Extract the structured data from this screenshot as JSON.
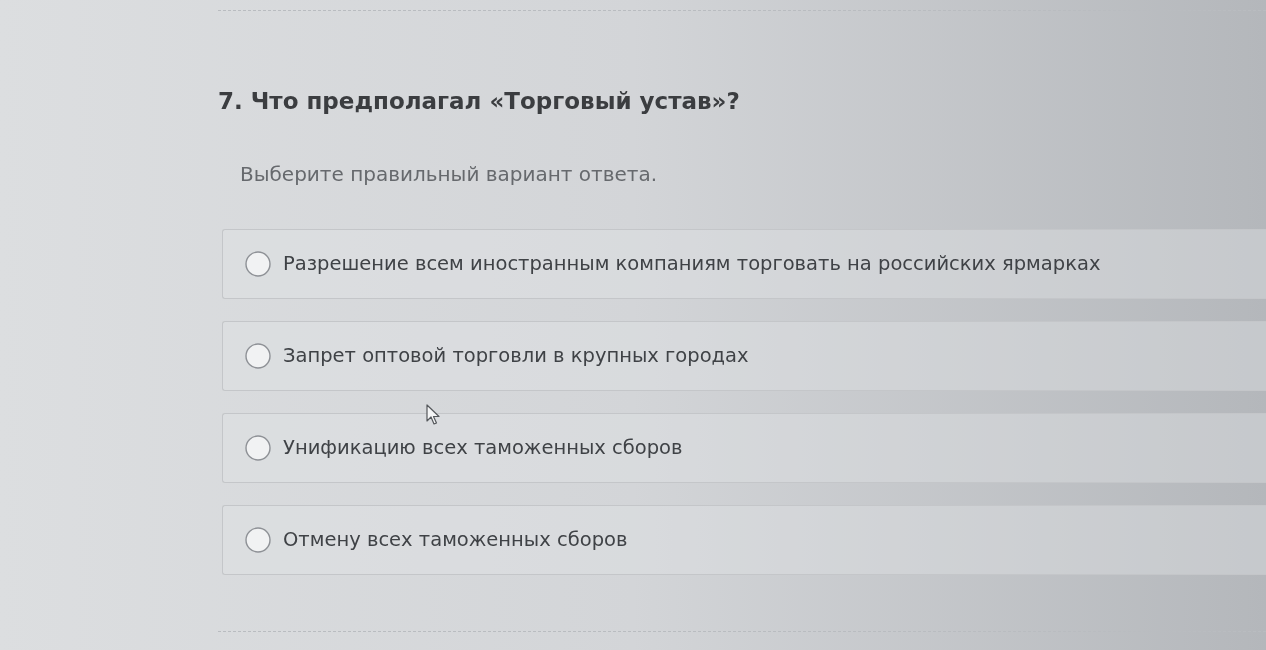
{
  "question": {
    "title": "7. Что предполагал «Торговый устав»?",
    "instruction": "Выберите правильный вариант ответа."
  },
  "options": [
    {
      "label": "Разрешение всем иностранным компаниям торговать на российских ярмарках",
      "selected": false
    },
    {
      "label": "Запрет оптовой торговли в крупных городах",
      "selected": false
    },
    {
      "label": "Унификацию всех таможенных сборов",
      "selected": false
    },
    {
      "label": "Отмену всех таможенных сборов",
      "selected": false
    }
  ]
}
